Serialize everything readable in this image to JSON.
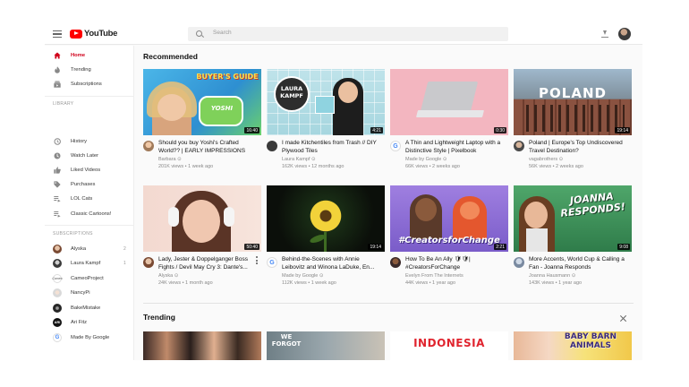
{
  "topbar": {
    "logo_text": "YouTube",
    "search_placeholder": "Search"
  },
  "sidebar": {
    "main": [
      {
        "label": "Home",
        "icon": "home-icon",
        "active": true
      },
      {
        "label": "Trending",
        "icon": "flame-icon"
      },
      {
        "label": "Subscriptions",
        "icon": "subscriptions-icon"
      }
    ],
    "library_heading": "LIBRARY",
    "library": [
      {
        "label": "History",
        "icon": "history-icon"
      },
      {
        "label": "Watch Later",
        "icon": "clock-icon"
      },
      {
        "label": "Liked Videos",
        "icon": "thumbs-up-icon"
      },
      {
        "label": "Purchases",
        "icon": "tag-icon"
      },
      {
        "label": "LOL Cats",
        "icon": "playlist-icon"
      },
      {
        "label": "Classic Cartoons!",
        "icon": "playlist-icon"
      }
    ],
    "subscriptions_heading": "SUBSCRIPTIONS",
    "subscriptions": [
      {
        "label": "Alyska",
        "count": "2",
        "color": "#c99a7f"
      },
      {
        "label": "Laura Kampf",
        "count": "1",
        "color": "#4a4a4a"
      },
      {
        "label": "CameoProject",
        "count": "",
        "color": "#ffffff"
      },
      {
        "label": "NancyPi",
        "count": "",
        "color": "#e7e7e7"
      },
      {
        "label": "BakeMistake",
        "count": "",
        "color": "#2c2c2c"
      },
      {
        "label": "Ari Fitz",
        "count": "",
        "color": "#111111"
      },
      {
        "label": "Made By Google",
        "count": "",
        "color": "#ffffff"
      }
    ]
  },
  "recommended": {
    "title": "Recommended",
    "videos": [
      {
        "title": "Should you buy Yoshi's Crafted World?? | EARLY IMPRESSIONS",
        "channel": "Barbara",
        "verified": "⊙",
        "meta": "201K views • 1 week ago",
        "duration": "16:40",
        "thumb_text": "BUYER'S GUIDE"
      },
      {
        "title": "I made Kitchentiles from Trash // DIY Plywood Tiles",
        "channel": "Laura Kampf",
        "verified": "⊙",
        "meta": "162K views • 12 months ago",
        "duration": "4:21",
        "thumb_text": "LAURA KAMPF"
      },
      {
        "title": "A Thin and Lightweight Laptop with a Distinctive Style | Pixelbook",
        "channel": "Made by Google",
        "verified": "⊙",
        "meta": "66K views • 2 weeks ago",
        "duration": "0:30",
        "thumb_text": ""
      },
      {
        "title": "Poland | Europe's Top Undiscovered Travel Destination?",
        "channel": "vagabrothers",
        "verified": "⊙",
        "meta": "56K views • 2 weeks ago",
        "duration": "19:14",
        "thumb_text": "POLAND"
      },
      {
        "title": "Lady, Jester & Doppelganger Boss Fights / Devil May Cry 3: Dante's...",
        "channel": "Alyska",
        "verified": "⊙",
        "meta": "24K views • 1 month ago",
        "duration": "50:40",
        "thumb_text": ""
      },
      {
        "title": "Behind-the-Scenes with Annie Leibovitz and Winona LaDuke, En...",
        "channel": "Made by Google",
        "verified": "⊙",
        "meta": "112K views • 1 week ago",
        "duration": "19:14",
        "thumb_text": ""
      },
      {
        "title": "How To Be An Ally 🛡🛡| #CreatorsForChange",
        "channel": "Evelyn From The Internets",
        "verified": "",
        "meta": "44K views • 1 year ago",
        "duration": "2:21",
        "thumb_text": "#CreatorsforChange"
      },
      {
        "title": "More Accents, World Cup & Calling a Fan - Joanna Responds",
        "channel": "Joanna Hausmann",
        "verified": "⊙",
        "meta": "143K views • 1 year ago",
        "duration": "9:08",
        "thumb_text": "JOANNA RESPONDS!"
      }
    ]
  },
  "trending": {
    "title": "Trending",
    "thumbs": [
      {
        "thumb_text": ""
      },
      {
        "thumb_text": "WE FORGOT"
      },
      {
        "thumb_text": "INDONESIA"
      },
      {
        "thumb_text": "BABY BARN ANIMALS"
      }
    ]
  }
}
